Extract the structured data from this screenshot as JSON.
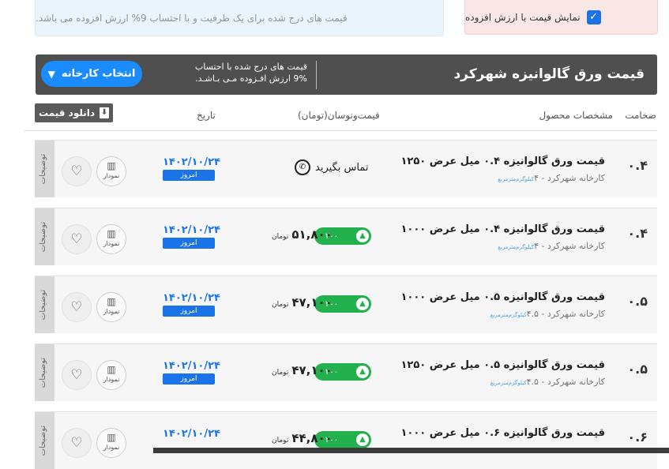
{
  "top": {
    "vat_label": "نمایش قیمت با ارزش افزوده",
    "vat_checked": true,
    "info_text": "قیمت های درج شده برای یک ظرفیت و با احتساب 9% ارزش افزوده می باشد."
  },
  "header": {
    "title": "قیمت ورق گالوانیزه شهرکرد",
    "note_line1": "قیمت های درج شده با احتساب",
    "note_line2": "9% ارزش افـزوده مـی بـاشـد.",
    "choose_label": "انتخاب کارخانه"
  },
  "columns": {
    "thickness": "ضخامت",
    "specs": "مشخصات محصول",
    "price": "قیمت‌ونوسان(تومان)",
    "date": "تاریخ",
    "download": "دانلود قیمت"
  },
  "rows": [
    {
      "thickness": "۰.۴",
      "name": "قیمت ورق گالوانیزه ۰.۴ میل عرض ۱۲۵۰",
      "factory": "کارخانه شهرکرد - ۴",
      "unit": "کیلوگرم‌مترمربع",
      "contact": "تماس بگیرید",
      "price": "",
      "currency": "",
      "change": "",
      "date": "۱۴۰۲/۱۰/۲۴",
      "today": "امروز",
      "chart": "نمودار",
      "desc": "توضیحات"
    },
    {
      "thickness": "۰.۴",
      "name": "قیمت ورق گالوانیزه ۰.۴ میل عرض ۱۰۰۰",
      "factory": "کارخانه شهرکرد - ۴",
      "unit": "کیلوگرم‌مترمربع",
      "contact": "",
      "price": "۵۱,۸۰۰",
      "currency": "تومان",
      "change": "۲۰۰",
      "date": "۱۴۰۲/۱۰/۲۴",
      "today": "امروز",
      "chart": "نمودار",
      "desc": "توضیحات"
    },
    {
      "thickness": "۰.۵",
      "name": "قیمت ورق گالوانیزه ۰.۵ میل عرض ۱۰۰۰",
      "factory": "کارخانه شهرکرد - ۴.۵",
      "unit": "کیلوگرم‌مترمربع",
      "contact": "",
      "price": "۴۷,۱۰۰",
      "currency": "تومان",
      "change": "۲۰۰",
      "date": "۱۴۰۲/۱۰/۲۴",
      "today": "امروز",
      "chart": "نمودار",
      "desc": "توضیحات"
    },
    {
      "thickness": "۰.۵",
      "name": "قیمت ورق گالوانیزه ۰.۵ میل عرض ۱۲۵۰",
      "factory": "کارخانه شهرکرد - ۴.۵",
      "unit": "کیلوگرم‌مترمربع",
      "contact": "",
      "price": "۴۷,۱۰۰",
      "currency": "تومان",
      "change": "۲۰۰",
      "date": "۱۴۰۲/۱۰/۲۴",
      "today": "امروز",
      "chart": "نمودار",
      "desc": "توضیحات"
    },
    {
      "thickness": "۰.۶",
      "name": "قیمت ورق گالوانیزه ۰.۶ میل عرض ۱۰۰۰",
      "factory": "",
      "unit": "",
      "contact": "",
      "price": "۴۴,۸۰۰",
      "currency": "تومان",
      "change": "۲۰۰",
      "date": "۱۴۰۲/۱۰/۲۴",
      "today": "",
      "chart": "نمودار",
      "desc": "توضیحات"
    }
  ]
}
